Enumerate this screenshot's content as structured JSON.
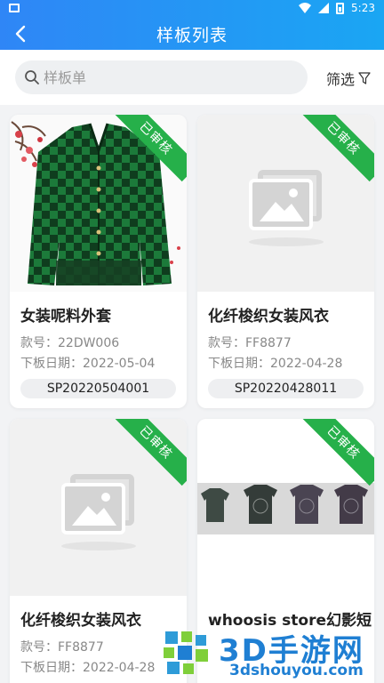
{
  "status": {
    "time": "5:23"
  },
  "nav": {
    "title": "样板列表",
    "back_icon": "chevron-left-icon"
  },
  "search": {
    "placeholder": "样板单",
    "value": ""
  },
  "filter": {
    "label": "筛选",
    "icon": "funnel-icon"
  },
  "cards": [
    {
      "badge": "已审核",
      "name": "女装呢料外套",
      "style_no": "款号：22DW006",
      "date": "下板日期：2022-05-04",
      "code": "SP20220504001",
      "image": "green-cardigan"
    },
    {
      "badge": "已审核",
      "name": "化纤梭织女装风衣",
      "style_no": "款号：FF8877",
      "date": "下板日期：2022-04-28",
      "code": "SP20220428011",
      "image": "placeholder"
    },
    {
      "badge": "已审核",
      "name": "化纤梭织女装风衣",
      "style_no": "款号：FF8877",
      "date": "下板日期：2022-04-28",
      "code": "",
      "image": "placeholder"
    },
    {
      "badge": "已审核",
      "name": "whoosis store幻影短",
      "style_no": "",
      "date": "",
      "code": "",
      "image": "tshirts"
    }
  ],
  "watermark": {
    "brand": "3D手游网",
    "domain": "3dshouyou.com"
  },
  "colors": {
    "header_start": "#2f86f6",
    "header_end": "#1aa6f3",
    "badge": "#26b04a"
  }
}
